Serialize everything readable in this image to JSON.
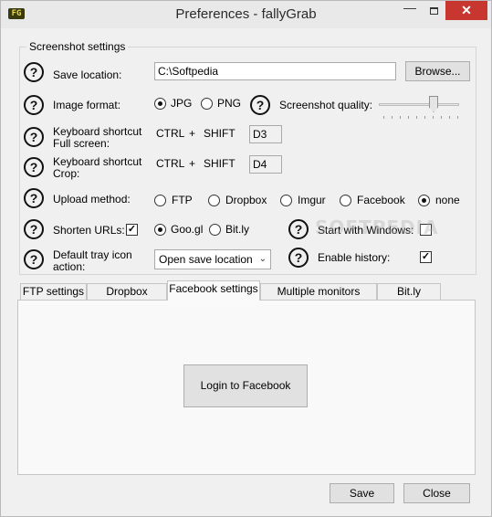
{
  "window": {
    "app_icon_text": "FG",
    "title": "Preferences - fallyGrab",
    "controls": {
      "minimize": "—",
      "close": "✕"
    }
  },
  "group": {
    "title": "Screenshot settings"
  },
  "help_glyph": "?",
  "save_location": {
    "label": "Save location:",
    "value": "C:\\Softpedia",
    "browse_label": "Browse..."
  },
  "image_format": {
    "label": "Image format:",
    "options": [
      {
        "label": "JPG",
        "selected": true
      },
      {
        "label": "PNG",
        "selected": false
      }
    ]
  },
  "screenshot_quality": {
    "label": "Screenshot quality:",
    "level_fraction": 0.7
  },
  "keyboard_fullscreen": {
    "label_line1": "Keyboard shortcut",
    "label_line2": "Full screen:",
    "mod1": "CTRL",
    "plus1": "+",
    "mod2": "SHIFT",
    "key": "D3"
  },
  "keyboard_crop": {
    "label_line1": "Keyboard shortcut",
    "label_line2": "Crop:",
    "mod1": "CTRL",
    "plus1": "+",
    "mod2": "SHIFT",
    "key": "D4"
  },
  "upload_method": {
    "label": "Upload method:",
    "options": [
      {
        "label": "FTP",
        "selected": false
      },
      {
        "label": "Dropbox",
        "selected": false
      },
      {
        "label": "Imgur",
        "selected": false
      },
      {
        "label": "Facebook",
        "selected": false
      },
      {
        "label": "none",
        "selected": true
      }
    ]
  },
  "shorten_urls": {
    "label": "Shorten URLs:",
    "checked": true,
    "check_glyph": "✓",
    "options": [
      {
        "label": "Goo.gl",
        "selected": true
      },
      {
        "label": "Bit.ly",
        "selected": false
      }
    ]
  },
  "start_with_windows": {
    "label": "Start with Windows:",
    "checked": false
  },
  "tray_icon_action": {
    "label_line1": "Default tray icon",
    "label_line2": "action:",
    "selected": "Open save location",
    "arrow": "⌄"
  },
  "enable_history": {
    "label": "Enable history:",
    "checked": true,
    "check_glyph": "✓"
  },
  "watermark": "SOFTPEDIA",
  "tabs": [
    {
      "label": "FTP settings",
      "active": false
    },
    {
      "label": "Dropbox settings",
      "active": false
    },
    {
      "label": "Facebook settings",
      "active": true
    },
    {
      "label": "Multiple monitors settings",
      "active": false
    },
    {
      "label": "Bit.ly settings",
      "active": false
    }
  ],
  "facebook_panel": {
    "login_label": "Login to Facebook"
  },
  "footer": {
    "save_label": "Save",
    "close_label": "Close"
  }
}
